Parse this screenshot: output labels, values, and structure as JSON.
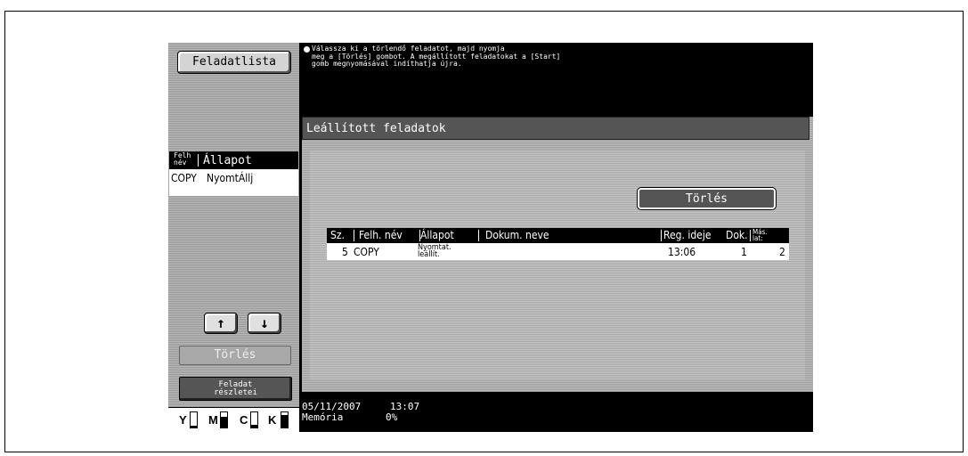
{
  "sidebar": {
    "job_list_button": "Feladatlista",
    "list_header_user": "Felh név",
    "list_header_state": "Állapot",
    "list_row": {
      "user": "COPY",
      "state": "NyomtÁllj"
    },
    "up_arrow": "↑",
    "down_arrow": "↓",
    "delete_button": "Törlés",
    "job_details_button": "Feladat részletei",
    "toner": [
      {
        "label": "Y",
        "level": 0.1
      },
      {
        "label": "M",
        "level": 0.7
      },
      {
        "label": "C",
        "level": 0.2
      },
      {
        "label": "K",
        "level": 0.85
      }
    ]
  },
  "message": {
    "line1": "Válassza ki a törlendő feladatot, majd nyomja",
    "line2": "meg a [Törlés] gombot. A megállított feladatokat a [Start]",
    "line3": "gomb megnyomásával indíthatja újra."
  },
  "main": {
    "title": "Leállított feladatok",
    "delete_button": "Törlés",
    "table": {
      "headers": {
        "no": "Sz.",
        "user": "Felh. név",
        "state": "Állapot",
        "doc": "Dokum. neve",
        "reg": "Reg. ideje",
        "docs": "Dok.",
        "copies": "Más. lat:"
      },
      "rows": [
        {
          "no": "5",
          "user": "COPY",
          "state_line1": "Nyomtat.",
          "state_line2": "leállít.",
          "doc": "",
          "reg": "13:06",
          "docs": "1",
          "copies": "2"
        }
      ]
    }
  },
  "footer": {
    "date": "05/11/2007",
    "time": "13:07",
    "memory_label": "Memória",
    "memory_value": "0%"
  }
}
